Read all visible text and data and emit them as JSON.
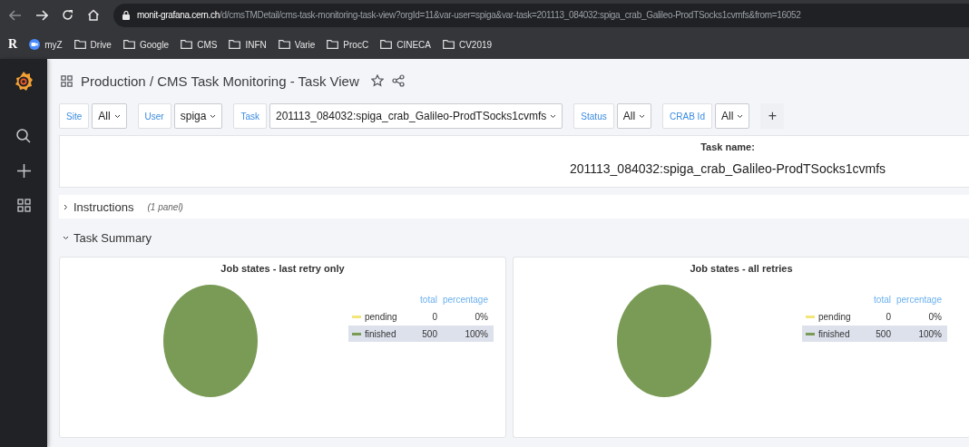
{
  "browser": {
    "url_host": "monit-grafana.cern.ch",
    "url_path": "/d/cmsTMDetail/cms-task-monitoring-task-view?orgId=11&var-user=spiga&var-task=201113_084032:spiga_crab_Galileo-ProdTSocks1cvmfs&from=16052",
    "bookmarks": [
      {
        "kind": "logo",
        "label": "R"
      },
      {
        "kind": "app",
        "label": "myZ"
      },
      {
        "kind": "folder",
        "label": "Drive"
      },
      {
        "kind": "folder",
        "label": "Google"
      },
      {
        "kind": "folder",
        "label": "CMS"
      },
      {
        "kind": "folder",
        "label": "INFN"
      },
      {
        "kind": "folder",
        "label": "Varie"
      },
      {
        "kind": "folder",
        "label": "ProcC"
      },
      {
        "kind": "folder",
        "label": "CINECA"
      },
      {
        "kind": "folder",
        "label": "CV2019"
      }
    ]
  },
  "dashboard": {
    "title": "Production / CMS Task Monitoring - Task View"
  },
  "variables": [
    {
      "label": "Site",
      "value": "All"
    },
    {
      "label": "User",
      "value": "spiga"
    },
    {
      "label": "Task",
      "value": "201113_084032:spiga_crab_Galileo-ProdTSocks1cvmfs"
    },
    {
      "label": "Status",
      "value": "All"
    },
    {
      "label": "CRAB Id",
      "value": "All"
    }
  ],
  "add_button": "+",
  "task_panel": {
    "heading": "Task name:",
    "value": "201113_084032:spiga_crab_Galileo-ProdTSocks1cvmfs"
  },
  "rows": [
    {
      "title": "Instructions",
      "note": "(1 panel)",
      "expanded": false
    },
    {
      "title": "Task Summary",
      "expanded": true
    }
  ],
  "panels": [
    {
      "title": "Job states - last retry only",
      "legend_headers": [
        "total",
        "percentage"
      ],
      "legend": [
        {
          "total": "0",
          "percentage": "0%",
          "selected": false
        },
        {
          "total": "500",
          "percentage": "100%",
          "selected": true
        }
      ],
      "chart_data": {
        "type": "pie",
        "categories": [
          "pending",
          "finished"
        ],
        "series": [
          {
            "values": [
              0,
              100
            ]
          }
        ],
        "colors": [
          "#f2e67a",
          "#7a9b56"
        ]
      }
    },
    {
      "title": "Job states - all retries",
      "legend_headers": [
        "total",
        "percentage"
      ],
      "legend": [
        {
          "total": "0",
          "percentage": "0%",
          "selected": false
        },
        {
          "total": "500",
          "percentage": "100%",
          "selected": true
        }
      ],
      "chart_data": {
        "type": "pie",
        "categories": [
          "pending",
          "finished"
        ],
        "series": [
          {
            "values": [
              0,
              100
            ]
          }
        ],
        "colors": [
          "#f2e67a",
          "#7a9b56"
        ]
      }
    }
  ]
}
